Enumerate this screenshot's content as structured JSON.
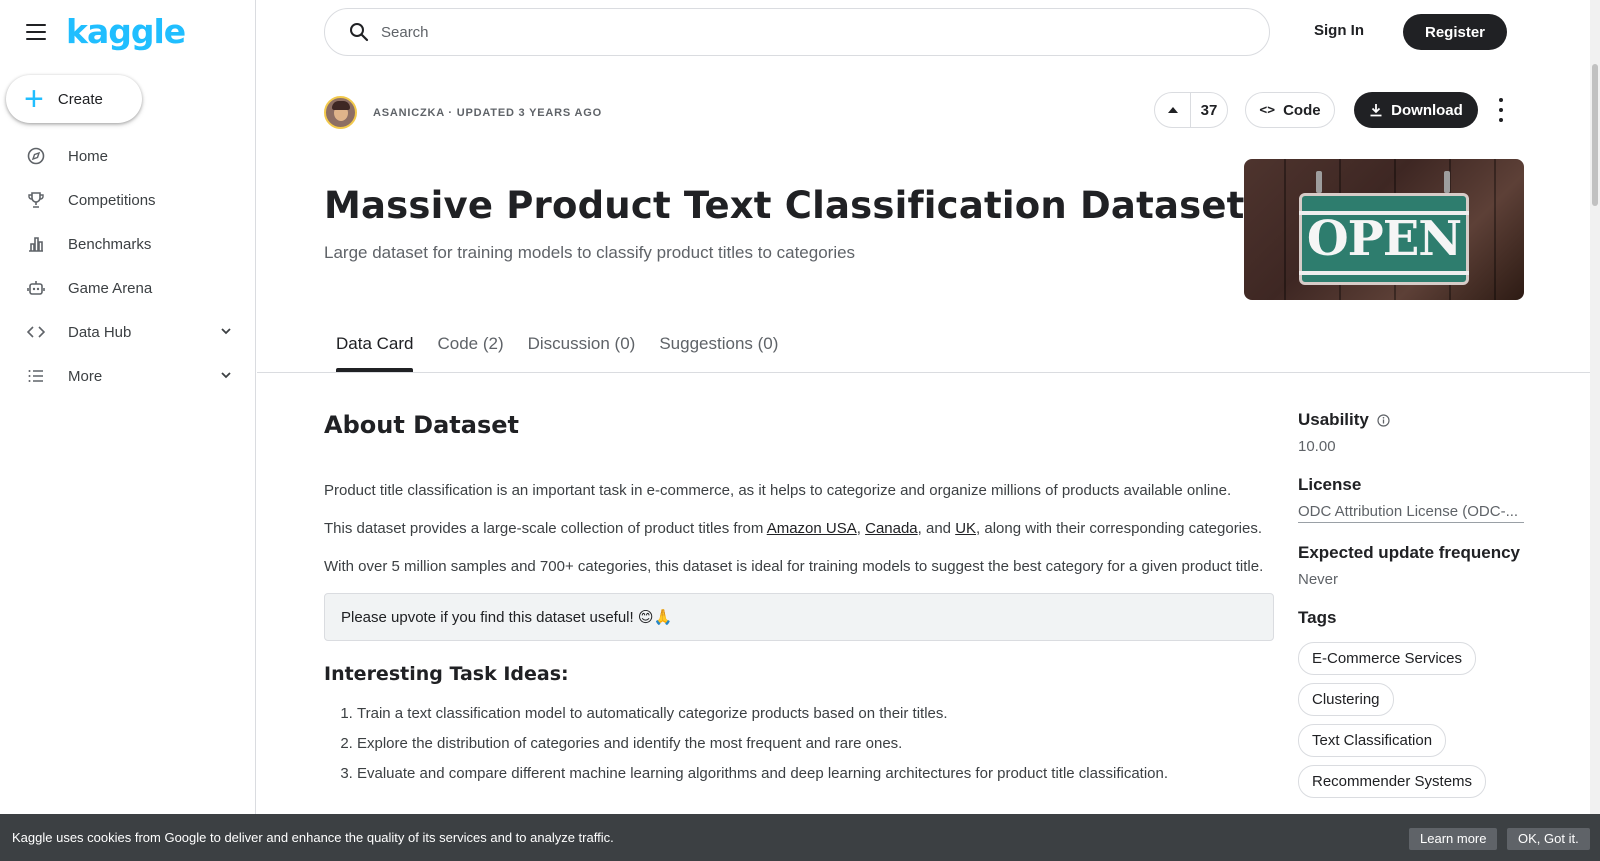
{
  "sidebar": {
    "logo": "kaggle",
    "create_label": "Create",
    "items": [
      {
        "label": "Home",
        "icon": "compass-icon"
      },
      {
        "label": "Competitions",
        "icon": "trophy-icon"
      },
      {
        "label": "Benchmarks",
        "icon": "bar-chart-icon"
      },
      {
        "label": "Game Arena",
        "icon": "robot-icon"
      },
      {
        "label": "Data Hub",
        "icon": "code-icon"
      },
      {
        "label": "More",
        "icon": "list-icon"
      }
    ]
  },
  "header": {
    "search_placeholder": "Search",
    "sign_in": "Sign In",
    "register": "Register"
  },
  "dataset": {
    "meta": "ASANICZKA · UPDATED 3 YEARS AGO",
    "upvotes": "37",
    "code_label": "Code",
    "download_label": "Download",
    "title": "Massive Product Text Classification Dataset",
    "subtitle": "Large dataset for training models to classify product titles to categories",
    "cover_text": "OPEN"
  },
  "tabs": [
    {
      "label": "Data Card",
      "active": true
    },
    {
      "label": "Code (2)",
      "active": false
    },
    {
      "label": "Discussion (0)",
      "active": false
    },
    {
      "label": "Suggestions (0)",
      "active": false
    }
  ],
  "about": {
    "heading": "About Dataset",
    "p1": "Product title classification is an important task in e-commerce, as it helps to categorize and organize millions of products available online.",
    "p2_before": "This dataset provides a large-scale collection of product titles from ",
    "p2_link1": "Amazon USA",
    "p2_sep1": ", ",
    "p2_link2": "Canada",
    "p2_sep2": ", and ",
    "p2_link3": "UK",
    "p2_after": ", along with their corresponding categories.",
    "p3": "With over 5 million samples and 700+ categories, this dataset is ideal for training models to suggest the best category for a given product title.",
    "callout": "Please upvote if you find this dataset useful! 😊🙏",
    "tasks_heading": "Interesting Task Ideas:",
    "tasks": [
      "Train a text classification model to automatically categorize products based on their titles.",
      "Explore the distribution of categories and identify the most frequent and rare ones.",
      "Evaluate and compare different machine learning algorithms and deep learning architectures for product title classification."
    ]
  },
  "sidebar_right": {
    "usability_label": "Usability",
    "usability_value": "10.00",
    "license_label": "License",
    "license_value": "ODC Attribution License (ODC-...",
    "freq_label": "Expected update frequency",
    "freq_value": "Never",
    "tags_label": "Tags",
    "tags": [
      "E-Commerce Services",
      "Clustering",
      "Text Classification",
      "Recommender Systems"
    ]
  },
  "cookie": {
    "message": "Kaggle uses cookies from Google to deliver and enhance the quality of its services and to analyze traffic.",
    "learn_more": "Learn more",
    "ok": "OK, Got it."
  },
  "colors": {
    "brand": "#20beff",
    "primary_dark": "#202124",
    "cookie_bg": "#3c4043"
  }
}
